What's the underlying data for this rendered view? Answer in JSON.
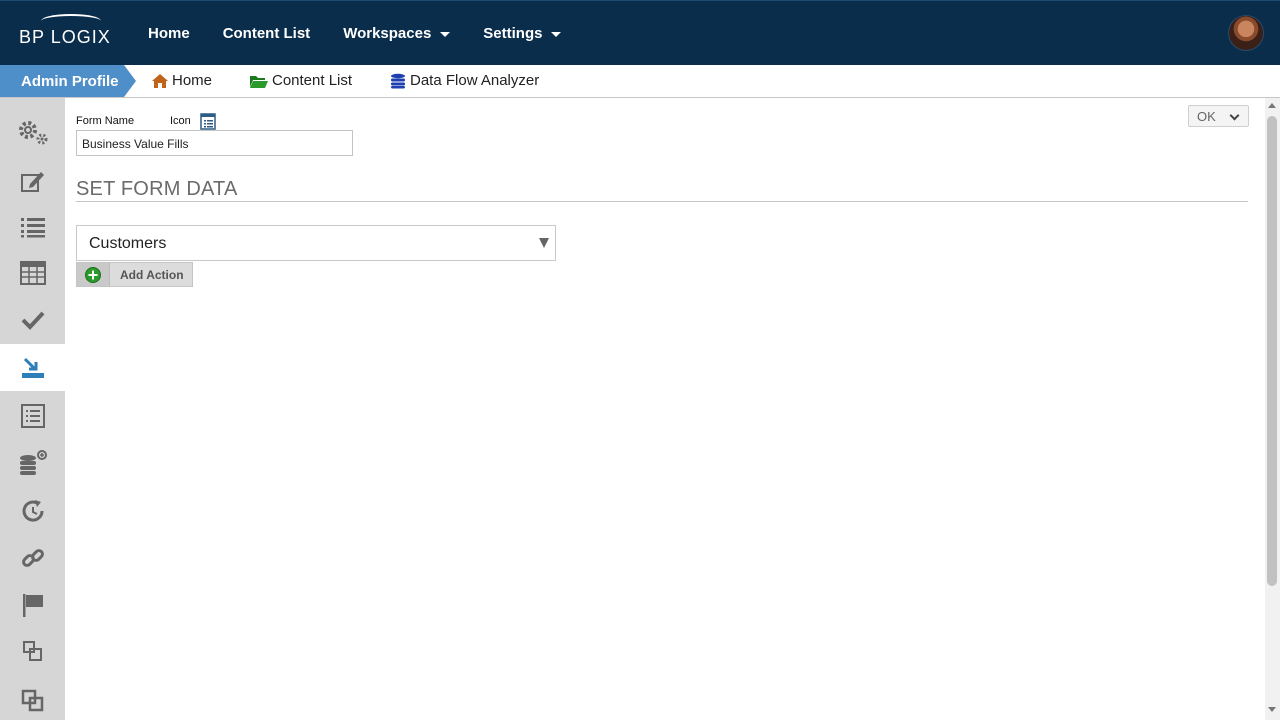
{
  "topnav": {
    "logo": "BP LOGIX",
    "items": [
      {
        "label": "Home",
        "has_caret": false
      },
      {
        "label": "Content List",
        "has_caret": false
      },
      {
        "label": "Workspaces",
        "has_caret": true
      },
      {
        "label": "Settings",
        "has_caret": true
      }
    ]
  },
  "breadcrumb": {
    "profile": "Admin Profile",
    "items": [
      {
        "label": "Home",
        "icon": "home-icon"
      },
      {
        "label": "Content List",
        "icon": "folder-open-icon"
      },
      {
        "label": "Data Flow Analyzer",
        "icon": "database-icon"
      }
    ]
  },
  "sidebar": {
    "items": [
      {
        "icon": "gears-icon",
        "active": false
      },
      {
        "icon": "edit-icon",
        "active": false
      },
      {
        "icon": "list-icon",
        "active": false
      },
      {
        "icon": "table-icon",
        "active": false
      },
      {
        "icon": "check-icon",
        "active": false
      },
      {
        "icon": "import-icon",
        "active": true
      },
      {
        "icon": "list-alt-icon",
        "active": false
      },
      {
        "icon": "database-add-icon",
        "active": false
      },
      {
        "icon": "refresh-clock-icon",
        "active": false
      },
      {
        "icon": "link-icon",
        "active": false
      },
      {
        "icon": "flag-icon",
        "active": false
      },
      {
        "icon": "clone-icon",
        "active": false
      },
      {
        "icon": "clone-alt-icon",
        "active": false
      }
    ]
  },
  "form": {
    "name_label": "Form Name",
    "icon_label": "Icon",
    "name_value": "Business Value Fills",
    "section_title": "SET FORM DATA",
    "dropdown_value": "Customers",
    "add_action_label": "Add Action",
    "ok_label": "OK"
  },
  "colors": {
    "topbar": "#0b2d4c",
    "profile_tab": "#4f8fc9",
    "sidebar": "#d6d6d6",
    "active_icon": "#2c7fb8",
    "add_icon": "#2a9a2a"
  }
}
